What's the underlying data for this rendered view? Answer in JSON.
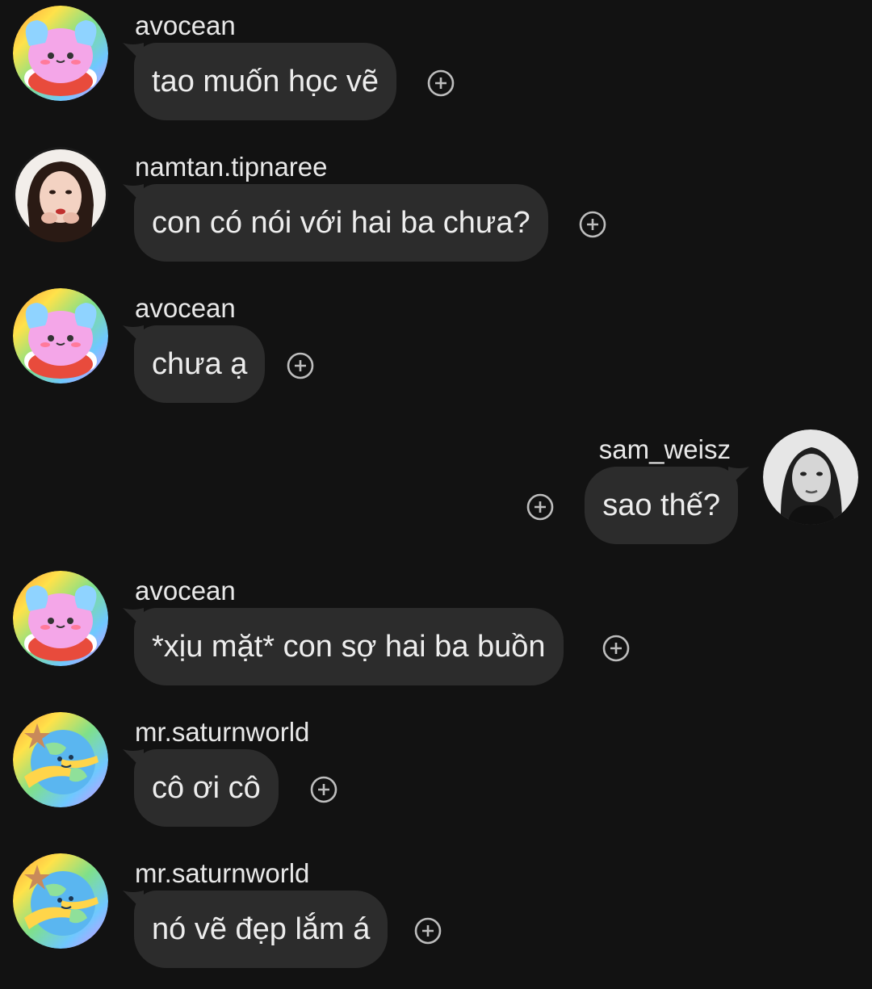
{
  "messages": [
    {
      "side": "left",
      "avatar": "blob-avatar",
      "username": "avocean",
      "text": "tao muốn học vẽ"
    },
    {
      "side": "left",
      "avatar": "girl-photo-avatar",
      "username": "namtan.tipnaree",
      "text": "con có nói với hai ba chưa?"
    },
    {
      "side": "left",
      "avatar": "blob-avatar",
      "username": "avocean",
      "text": "chưa ạ"
    },
    {
      "side": "right",
      "avatar": "bw-photo-avatar",
      "username": "sam_weisz",
      "text": "sao thế?"
    },
    {
      "side": "left",
      "avatar": "blob-avatar",
      "username": "avocean",
      "text": "*xịu mặt* con sợ hai ba buồn"
    },
    {
      "side": "left",
      "avatar": "globe-avatar",
      "username": "mr.saturnworld",
      "text": "cô ơi cô"
    },
    {
      "side": "left",
      "avatar": "globe-avatar",
      "username": "mr.saturnworld",
      "text": "nó vẽ đẹp lắm á"
    }
  ],
  "icons": {
    "reaction": "add-reaction-icon"
  },
  "colors": {
    "background": "#121212",
    "bubble": "#2c2c2c",
    "text": "#ededed",
    "icon": "#bdbdbd"
  }
}
